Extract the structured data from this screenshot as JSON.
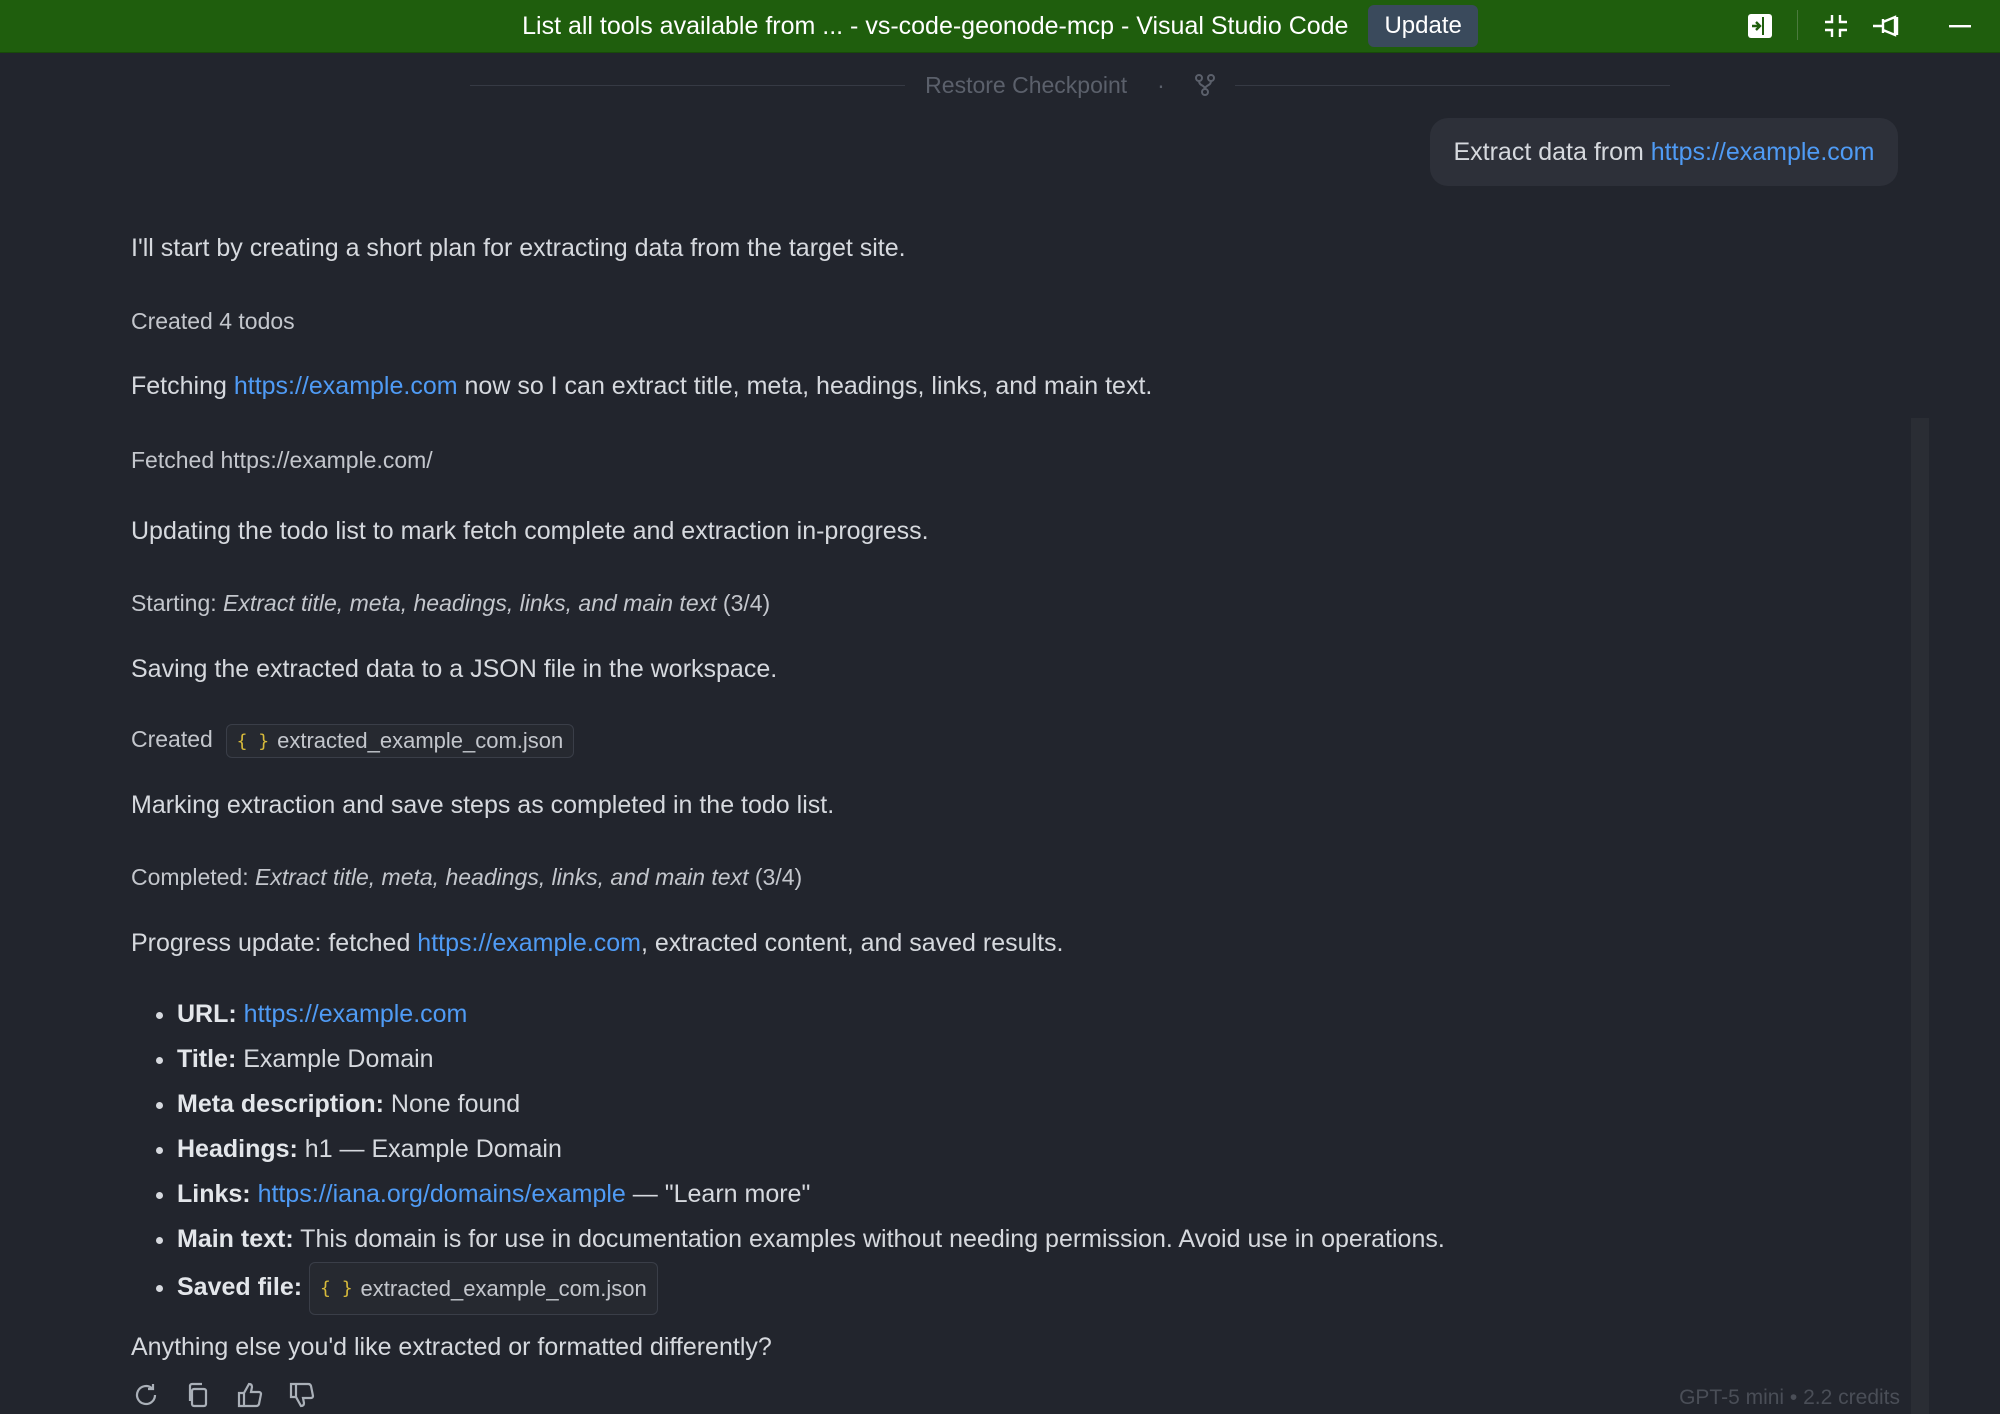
{
  "titlebar": {
    "title": "List all tools available from ... - vs-code-geonode-mcp - Visual Studio Code",
    "update_label": "Update",
    "icons": [
      "toggle-panel-icon",
      "exit-fullscreen-icon",
      "unpin-icon",
      "minimize-icon"
    ]
  },
  "checkpoint": {
    "label": "Restore Checkpoint",
    "separator": "·"
  },
  "user_message": {
    "prefix": "Extract data from ",
    "url": "https://example.com"
  },
  "messages": {
    "m1": "I'll start by creating a short plan for extracting data from the target site.",
    "m2": "Created 4 todos",
    "m3_prefix": "Fetching ",
    "m3_url": "https://example.com",
    "m3_suffix": " now so I can extract title, meta, headings, links, and main text.",
    "m4": "Fetched https://example.com/",
    "m5": "Updating the todo list to mark fetch complete and extraction in-progress.",
    "m6_prefix": "Starting: ",
    "m6_task": "Extract title, meta, headings, links, and main text",
    "m6_suffix": " (3/4)",
    "m7": "Saving the extracted data to a JSON file in the workspace.",
    "m8_prefix": "Created ",
    "m8_file": "extracted_example_com.json",
    "m9": "Marking extraction and save steps as completed in the todo list.",
    "m10_prefix": "Completed: ",
    "m10_task": "Extract title, meta, headings, links, and main text",
    "m10_suffix": " (3/4)",
    "m11_prefix": "Progress update: fetched ",
    "m11_url": "https://example.com",
    "m11_suffix": ", extracted content, and saved results.",
    "closing": "Anything else you'd like extracted or formatted differently?"
  },
  "summary": {
    "url_label": "URL:",
    "url_value": "https://example.com",
    "title_label": "Title:",
    "title_value": " Example Domain",
    "meta_label": "Meta description:",
    "meta_value": " None found",
    "headings_label": "Headings:",
    "headings_value": " h1 — Example Domain",
    "links_label": "Links:",
    "links_url": "https://iana.org/domains/example",
    "links_suffix": " — \"Learn more\"",
    "main_label": "Main text:",
    "main_value": " This domain is for use in documentation examples without needing permission. Avoid use in operations.",
    "saved_label": "Saved file:",
    "saved_value": "extracted_example_com.json"
  },
  "actions": [
    "retry-icon",
    "copy-icon",
    "thumbs-up-icon",
    "thumbs-down-icon"
  ],
  "model_info": "GPT-5 mini • 2.2 credits",
  "colors": {
    "titlebar": "#1f5e0d",
    "background": "#22252d",
    "link": "#4f9bf5",
    "json_brace": "#d7ba3b"
  }
}
